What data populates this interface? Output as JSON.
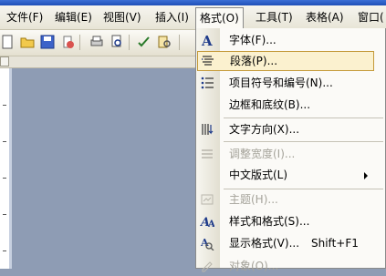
{
  "menubar": {
    "items": [
      {
        "label": "文件(F)"
      },
      {
        "label": "编辑(E)"
      },
      {
        "label": "视图(V)"
      },
      {
        "label": "插入(I)"
      },
      {
        "label": "格式(O)"
      },
      {
        "label": "工具(T)"
      },
      {
        "label": "表格(A)"
      },
      {
        "label": "窗口("
      }
    ]
  },
  "format_menu": {
    "items": [
      {
        "label": "字体(F)...",
        "icon": "font-A-icon",
        "disabled": false
      },
      {
        "label": "段落(P)...",
        "icon": "paragraph-icon",
        "disabled": false,
        "highlighted": true
      },
      {
        "label": "项目符号和编号(N)...",
        "icon": "bullets-numbering-icon",
        "disabled": false
      },
      {
        "label": "边框和底纹(B)...",
        "icon": "",
        "disabled": false
      },
      {
        "label": "文字方向(X)...",
        "icon": "text-direction-icon",
        "disabled": false
      },
      {
        "label": "调整宽度(I)...",
        "icon": "adjust-width-icon",
        "disabled": true
      },
      {
        "label": "中文版式(L)",
        "icon": "",
        "disabled": false,
        "submenu": true
      },
      {
        "label": "主题(H)...",
        "icon": "theme-icon",
        "disabled": true
      },
      {
        "label": "样式和格式(S)...",
        "icon": "styles-formatting-icon",
        "disabled": false
      },
      {
        "label": "显示格式(V)...",
        "icon": "reveal-formatting-icon",
        "disabled": false,
        "shortcut": "Shift+F1"
      },
      {
        "label": "对象(O)...",
        "icon": "object-icon",
        "disabled": true
      }
    ]
  },
  "colors": {
    "highlight_bg": "#fbf1cf",
    "highlight_border": "#c49a3a",
    "workspace": "#8e9cb4"
  }
}
